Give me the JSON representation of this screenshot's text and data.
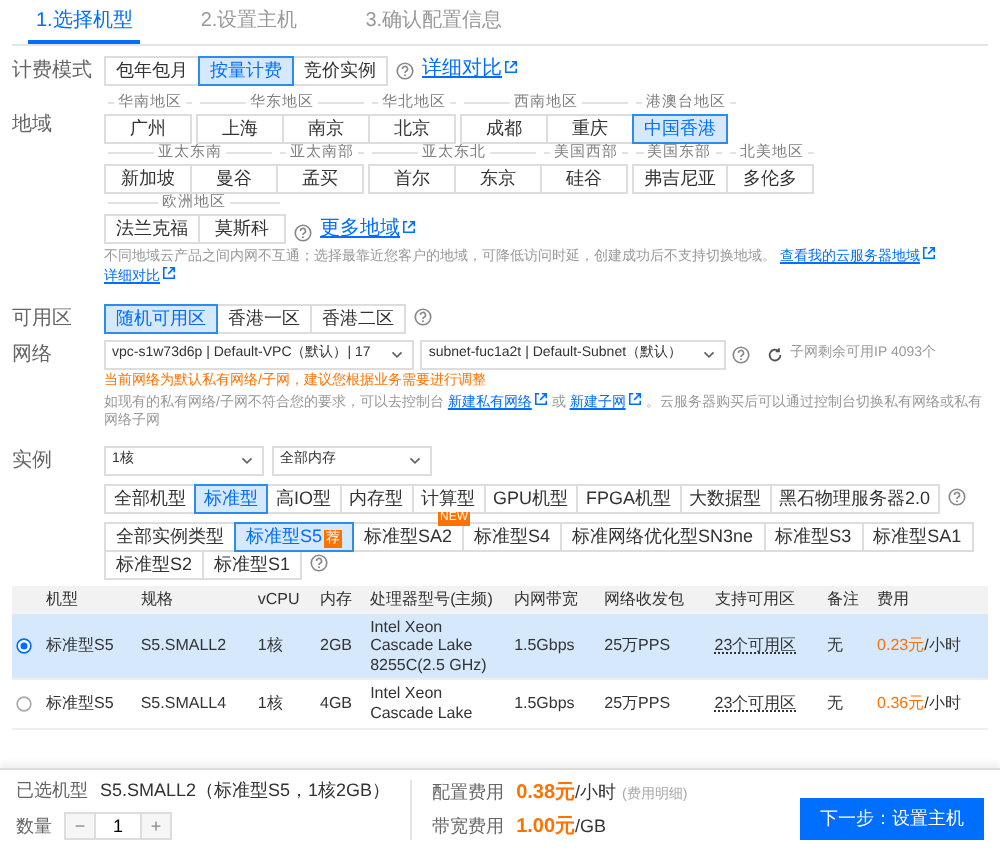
{
  "steps": [
    {
      "label": "1.选择机型",
      "selected": true
    },
    {
      "label": "2.设置主机",
      "selected": false
    },
    {
      "label": "3.确认配置信息",
      "selected": false
    }
  ],
  "billing": {
    "label": "计费模式",
    "options": [
      {
        "label": "包年包月",
        "selected": false
      },
      {
        "label": "按量计费",
        "selected": true
      },
      {
        "label": "竞价实例",
        "selected": false
      }
    ],
    "link": "详细对比"
  },
  "region": {
    "label": "地域",
    "rows": [
      [
        {
          "group": "华南地区",
          "options": [
            {
              "label": "广州",
              "selected": false
            }
          ]
        },
        {
          "group": "华东地区",
          "options": [
            {
              "label": "上海",
              "selected": false
            },
            {
              "label": "南京",
              "selected": false
            }
          ]
        },
        {
          "group": "华北地区",
          "options": [
            {
              "label": "北京",
              "selected": false
            }
          ]
        },
        {
          "group": "西南地区",
          "options": [
            {
              "label": "成都",
              "selected": false
            },
            {
              "label": "重庆",
              "selected": false
            }
          ]
        },
        {
          "group": "港澳台地区",
          "options": [
            {
              "label": "中国香港",
              "selected": true
            }
          ]
        }
      ],
      [
        {
          "group": "亚太东南",
          "options": [
            {
              "label": "新加坡",
              "selected": false
            },
            {
              "label": "曼谷",
              "selected": false
            }
          ]
        },
        {
          "group": "亚太南部",
          "options": [
            {
              "label": "孟买",
              "selected": false
            }
          ]
        },
        {
          "group": "亚太东北",
          "options": [
            {
              "label": "首尔",
              "selected": false
            },
            {
              "label": "东京",
              "selected": false
            }
          ]
        },
        {
          "group": "美国西部",
          "options": [
            {
              "label": "硅谷",
              "selected": false
            }
          ]
        },
        {
          "group": "美国东部",
          "options": [
            {
              "label": "弗吉尼亚",
              "selected": false
            }
          ]
        },
        {
          "group": "北美地区",
          "options": [
            {
              "label": "多伦多",
              "selected": false
            }
          ]
        }
      ],
      [
        {
          "group": "欧洲地区",
          "options": [
            {
              "label": "法兰克福",
              "selected": false
            },
            {
              "label": "莫斯科",
              "selected": false
            }
          ]
        }
      ]
    ],
    "more_link": "更多地域",
    "note": "不同地域云产品之间内网不互通；选择最靠近您客户的地域，可降低访问时延，创建成功后不支持切换地域。",
    "note_links": [
      "查看我的云服务器地域",
      "详细对比"
    ]
  },
  "zone": {
    "label": "可用区",
    "options": [
      {
        "label": "随机可用区",
        "selected": true
      },
      {
        "label": "香港一区",
        "selected": false
      },
      {
        "label": "香港二区",
        "selected": false
      }
    ]
  },
  "network": {
    "label": "网络",
    "vpc": "vpc-s1w73d6p | Default-VPC（默认）| 17",
    "subnet": "subnet-fuc1a2t | Default-Subnet（默认）",
    "ip_info": "子网剩余可用IP 4093个",
    "warning": "当前网络为默认私有网络/子网，建议您根据业务需要进行调整",
    "hint": [
      {
        "kind": "text",
        "text": "如现有的私有网络/子网不符合您的要求，可以去控制台"
      },
      {
        "kind": "link",
        "text": "新建私有网络"
      },
      {
        "kind": "text",
        "text": "或"
      },
      {
        "kind": "link",
        "text": "新建子网"
      },
      {
        "kind": "text",
        "text": "。云服务器购买后可以通过控制台切换私有网络或私有网络子网"
      }
    ]
  },
  "instance": {
    "label": "实例",
    "cpu": "1核",
    "memory": "全部内存",
    "families": [
      {
        "label": "全部机型",
        "selected": false
      },
      {
        "label": "标准型",
        "selected": true
      },
      {
        "label": "高IO型",
        "selected": false
      },
      {
        "label": "内存型",
        "selected": false
      },
      {
        "label": "计算型",
        "selected": false
      },
      {
        "label": "GPU机型",
        "selected": false
      },
      {
        "label": "FPGA机型",
        "selected": false
      },
      {
        "label": "大数据型",
        "selected": false
      },
      {
        "label": "黑石物理服务器2.0",
        "selected": false
      }
    ],
    "types": [
      {
        "label": "全部实例类型",
        "selected": false
      },
      {
        "label": "标准型S5",
        "selected": true,
        "badge": "荐"
      },
      {
        "label": "标准型SA2",
        "selected": false,
        "badge": "NEW"
      },
      {
        "label": "标准型S4",
        "selected": false
      },
      {
        "label": "标准网络优化型SN3ne",
        "selected": false
      },
      {
        "label": "标准型S3",
        "selected": false
      },
      {
        "label": "标准型SA1",
        "selected": false
      },
      {
        "label": "标准型S2",
        "selected": false
      },
      {
        "label": "标准型S1",
        "selected": false
      }
    ]
  },
  "table": {
    "columns": [
      "机型",
      "规格",
      "vCPU",
      "内存",
      "处理器型号(主频)",
      "内网带宽",
      "网络收发包",
      "支持可用区",
      "备注",
      "费用"
    ],
    "rows": [
      {
        "selected": true,
        "cells": [
          "标准型S5",
          "S5.SMALL2",
          "1核",
          "2GB",
          "Intel Xeon Cascade Lake 8255C(2.5 GHz)",
          "1.5Gbps",
          "25万PPS",
          "23个可用区",
          "无"
        ],
        "price": "0.23元",
        "unit": "/小时"
      },
      {
        "selected": false,
        "cells": [
          "标准型S5",
          "S5.SMALL4",
          "1核",
          "4GB",
          "Intel Xeon Cascade Lake",
          "1.5Gbps",
          "25万PPS",
          "23个可用区",
          "无"
        ],
        "price": "0.36元",
        "unit": "/小时"
      }
    ]
  },
  "footer": {
    "chosen_label": "已选机型",
    "chosen": "S5.SMALL2（标准型S5，1核2GB）",
    "qty_label": "数量",
    "minus": "−",
    "qty": "1",
    "plus": "+",
    "config_label": "配置费用",
    "config_price": "0.38元",
    "config_unit": "/小时",
    "config_detail": "(费用明细)",
    "bw_label": "带宽费用",
    "bw_price": "1.00元",
    "bw_unit": "/GB",
    "next": "下一步：设置主机"
  }
}
